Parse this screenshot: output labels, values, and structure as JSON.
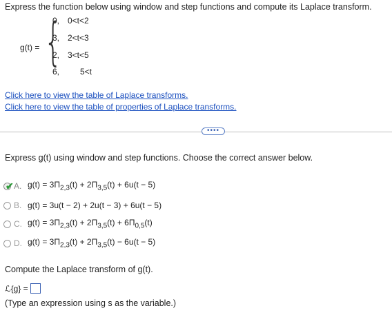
{
  "prompt": "Express the function below using window and step functions and compute its Laplace transform.",
  "function": {
    "label": "g(t) =",
    "cases": [
      {
        "value": "0,",
        "condition": "0<t<2"
      },
      {
        "value": "3,",
        "condition": "2<t<3"
      },
      {
        "value": "2,",
        "condition": "3<t<5"
      },
      {
        "value": "6,",
        "condition": "5<t"
      }
    ]
  },
  "links": {
    "laplace_table": "Click here to view the table of Laplace transforms.",
    "properties_table": "Click here to view the table of properties of Laplace transforms."
  },
  "expand_button": "••••",
  "question": "Express g(t) using window and step functions. Choose the correct answer below.",
  "options": [
    {
      "letter": "A.",
      "selected": true,
      "correct": true
    },
    {
      "letter": "B.",
      "selected": false
    },
    {
      "letter": "C.",
      "selected": false
    },
    {
      "letter": "D.",
      "selected": false
    }
  ],
  "compute_prompt": "Compute the Laplace transform of g(t).",
  "laplace_label": "ℒ{g} =",
  "answer_value": "",
  "hint": "(Type an expression using s as the variable.)"
}
